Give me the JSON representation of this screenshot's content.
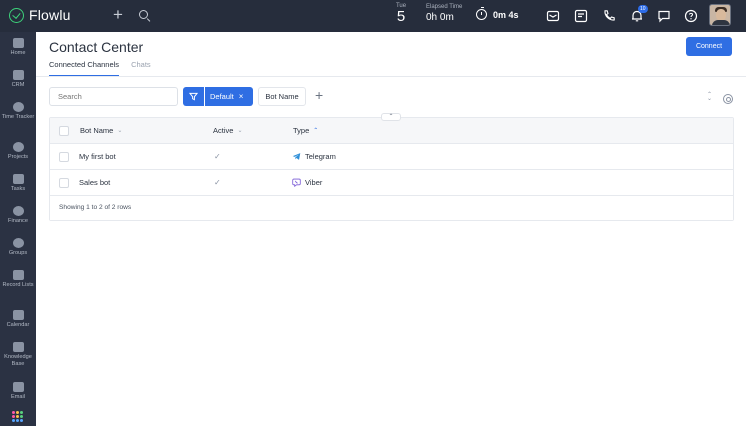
{
  "app": {
    "logo_text": "Flowlu"
  },
  "topbar": {
    "date_day": "Tue",
    "date_num": "5",
    "elapsed_label": "Elapsed Time",
    "elapsed_value": "0h 0m",
    "timer_value": "0m 4s",
    "notifications_count": "10"
  },
  "sidebar": {
    "items": [
      {
        "label": "Home",
        "icon": "home-icon"
      },
      {
        "label": "CRM",
        "icon": "crm-icon"
      },
      {
        "label": "Time Tracker",
        "icon": "time-tracker-icon"
      },
      {
        "label": "Projects",
        "icon": "projects-icon"
      },
      {
        "label": "Tasks",
        "icon": "tasks-icon"
      },
      {
        "label": "Finance",
        "icon": "finance-icon"
      },
      {
        "label": "Groups",
        "icon": "groups-icon"
      },
      {
        "label": "Record Lists",
        "icon": "record-lists-icon"
      },
      {
        "label": "Calendar",
        "icon": "calendar-icon"
      },
      {
        "label": "Knowledge Base",
        "icon": "knowledge-base-icon"
      },
      {
        "label": "Email",
        "icon": "email-icon"
      }
    ]
  },
  "page": {
    "title": "Contact Center",
    "connect_label": "Connect",
    "tabs": [
      {
        "label": "Connected Channels",
        "active": true
      },
      {
        "label": "Chats",
        "active": false
      }
    ]
  },
  "filters": {
    "search_placeholder": "Search",
    "active_filter": "Default",
    "column_chip": "Bot Name",
    "add_symbol": "+"
  },
  "table": {
    "columns": [
      "Bot Name",
      "Active",
      "Type"
    ],
    "rows": [
      {
        "name": "My first bot",
        "active": "✓",
        "type": "Telegram",
        "type_icon": "telegram-icon"
      },
      {
        "name": "Sales bot",
        "active": "✓",
        "type": "Viber",
        "type_icon": "viber-icon"
      }
    ],
    "footer": "Showing 1 to 2 of 2 rows"
  },
  "colors": {
    "accent": "#2f6ee3",
    "topbar": "#262d3c",
    "sidebar": "#2b3243"
  }
}
